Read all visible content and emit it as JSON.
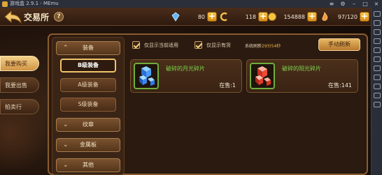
{
  "window": {
    "title": "游戏盒 2.9.1 - MEmu"
  },
  "header": {
    "title": "交易所",
    "help_symbol": "?",
    "resources": [
      {
        "icon": "crystal-icon",
        "value": "80"
      },
      {
        "icon": "c-token-icon",
        "value": "118"
      },
      {
        "icon": "gold-coin-icon",
        "value": "154888"
      },
      {
        "icon": "stamina-icon",
        "value": "97/120"
      }
    ]
  },
  "main_tabs": [
    {
      "label": "我要购买",
      "active": true
    },
    {
      "label": "我要出售",
      "active": false
    },
    {
      "label": "拍卖行",
      "active": false
    }
  ],
  "categories": {
    "equipment": "装备",
    "sub": [
      {
        "label": "B级装备",
        "active": true
      },
      {
        "label": "A级装备",
        "active": false
      },
      {
        "label": "S级装备",
        "active": false
      }
    ],
    "emblem": "纹章",
    "metal": "金属板",
    "other": "其他"
  },
  "filters": {
    "usable_only": "仅显示当前适用",
    "in_stock_only": "仅显示有货",
    "refresh_prefix": "系统刷新",
    "refresh_time": "29分54秒",
    "manual_refresh": "手动刷新"
  },
  "items": [
    {
      "name": "破碎的月光碎片",
      "stock": "在售:1",
      "color": "#7fd64a"
    },
    {
      "name": "破碎的阳光碎片",
      "stock": "在售:141",
      "color": "#7fd64a"
    }
  ],
  "colors": {
    "accent": "#f3c46a",
    "item_green": "#7fd64a",
    "panel_border": "#8a5c30"
  }
}
